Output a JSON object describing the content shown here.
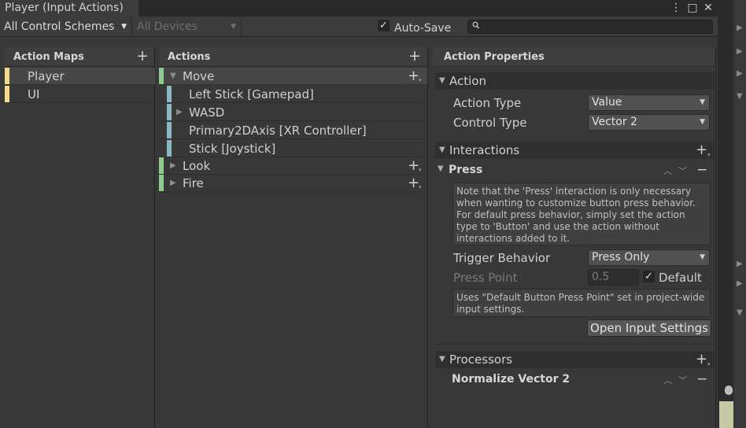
{
  "window": {
    "title": "Player (Input Actions)",
    "menu_icon": "⋮",
    "maximize_icon": "□",
    "close_icon": "✕"
  },
  "toolbar": {
    "control_schemes": "All Control Schemes",
    "devices": "All Devices",
    "autosave_checked": true,
    "autosave_label": "Auto-Save",
    "search_placeholder": ""
  },
  "action_maps": {
    "header": "Action Maps",
    "items": [
      {
        "label": "Player",
        "selected": true
      },
      {
        "label": "UI",
        "selected": false
      }
    ]
  },
  "actions": {
    "header": "Actions",
    "items": [
      {
        "label": "Move",
        "kind": "action",
        "expanded": true
      },
      {
        "label": "Left Stick [Gamepad]",
        "kind": "binding"
      },
      {
        "label": "WASD",
        "kind": "composite"
      },
      {
        "label": "Primary2DAxis [XR Controller]",
        "kind": "binding"
      },
      {
        "label": "Stick [Joystick]",
        "kind": "binding"
      },
      {
        "label": "Look",
        "kind": "action",
        "expanded": false
      },
      {
        "label": "Fire",
        "kind": "action",
        "expanded": false
      }
    ]
  },
  "properties": {
    "header": "Action Properties",
    "action_section": "Action",
    "action_type_label": "Action Type",
    "action_type_value": "Value",
    "control_type_label": "Control Type",
    "control_type_value": "Vector 2",
    "interactions_section": "Interactions",
    "press_title": "Press",
    "press_help": "Note that the 'Press' interaction is only necessary when wanting to customize button press behavior. For default press behavior, simply set the action type to 'Button' and use the action without interactions added to it.",
    "trigger_behavior_label": "Trigger Behavior",
    "trigger_behavior_value": "Press Only",
    "press_point_label": "Press Point",
    "press_point_value": "0.5",
    "default_checked": true,
    "default_label": "Default",
    "press_point_help": "Uses \"Default Button Press Point\" set in project-wide input settings.",
    "open_settings_button": "Open Input Settings",
    "processors_section": "Processors",
    "processor_name": "Normalize Vector 2"
  },
  "colors": {
    "action_map_stripe": "#f2d98b",
    "action_stripe": "#8fc98f",
    "binding_stripe": "#8ab7c4"
  }
}
